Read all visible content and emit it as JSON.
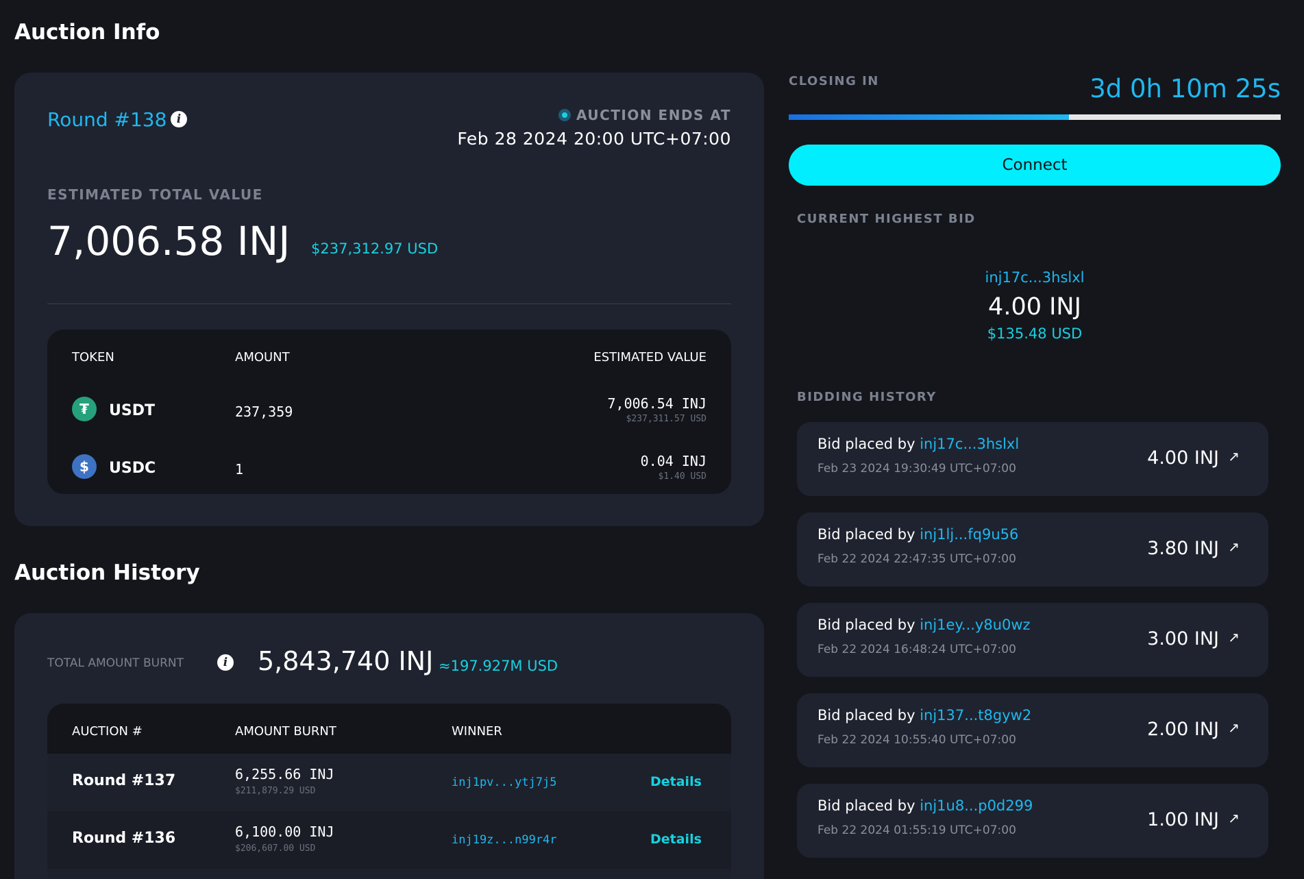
{
  "colors": {
    "background": "#14161c",
    "card": "#1f232f",
    "inner": "#13151b",
    "accent": "#1fb8f0",
    "connect_button": "#00eefe",
    "usd": "#18d1e0",
    "progress_fill": "#1f8ef0",
    "progress_track": "#e6e6e6"
  },
  "auction_info": {
    "title": "Auction Info",
    "round": "Round #138",
    "ends_label": "AUCTION ENDS AT",
    "ends_at": "Feb 28 2024 20:00 UTC+07:00",
    "est_label": "ESTIMATED TOTAL VALUE",
    "est_inj": "7,006.58 INJ",
    "est_usd": "$237,312.97 USD",
    "table": {
      "headers": {
        "token": "TOKEN",
        "amount": "AMOUNT",
        "value": "ESTIMATED VALUE"
      },
      "rows": [
        {
          "token": "USDT",
          "icon": "tether-icon",
          "amount": "237,359",
          "inj": "7,006.54 INJ",
          "usd": "$237,311.57 USD"
        },
        {
          "token": "USDC",
          "icon": "usdc-icon",
          "amount": "1",
          "inj": "0.04 INJ",
          "usd": "$1.40 USD"
        }
      ]
    }
  },
  "auction_history": {
    "title": "Auction History",
    "burnt_label": "TOTAL AMOUNT BURNT",
    "burnt_inj": "5,843,740 INJ",
    "burnt_usd": "≈197.927M USD",
    "headers": {
      "auction": "AUCTION #",
      "amount": "AMOUNT BURNT",
      "winner": "WINNER"
    },
    "rows": [
      {
        "round": "Round #137",
        "inj": "6,255.66 INJ",
        "usd": "$211,879.29 USD",
        "winner": "inj1pv...ytj7j5",
        "details": "Details"
      },
      {
        "round": "Round #136",
        "inj": "6,100.00 INJ",
        "usd": "$206,607.00 USD",
        "winner": "inj19z...n99r4r",
        "details": "Details"
      }
    ]
  },
  "closing": {
    "label": "CLOSING IN",
    "countdown": "3d 0h 10m 25s",
    "progress_percent": 57,
    "connect": "Connect"
  },
  "highest_bid": {
    "label": "CURRENT HIGHEST BID",
    "address": "inj17c...3hslxl",
    "inj": "4.00 INJ",
    "usd": "$135.48 USD"
  },
  "bidding_history": {
    "label": "BIDDING HISTORY",
    "prefix": "Bid placed by",
    "bids": [
      {
        "address": "inj17c...3hslxl",
        "time": "Feb 23 2024 19:30:49 UTC+07:00",
        "amount": "4.00 INJ"
      },
      {
        "address": "inj1lj...fq9u56",
        "time": "Feb 22 2024 22:47:35 UTC+07:00",
        "amount": "3.80 INJ"
      },
      {
        "address": "inj1ey...y8u0wz",
        "time": "Feb 22 2024 16:48:24 UTC+07:00",
        "amount": "3.00 INJ"
      },
      {
        "address": "inj137...t8gyw2",
        "time": "Feb 22 2024 10:55:40 UTC+07:00",
        "amount": "2.00 INJ"
      },
      {
        "address": "inj1u8...p0d299",
        "time": "Feb 22 2024 01:55:19 UTC+07:00",
        "amount": "1.00 INJ"
      }
    ]
  }
}
